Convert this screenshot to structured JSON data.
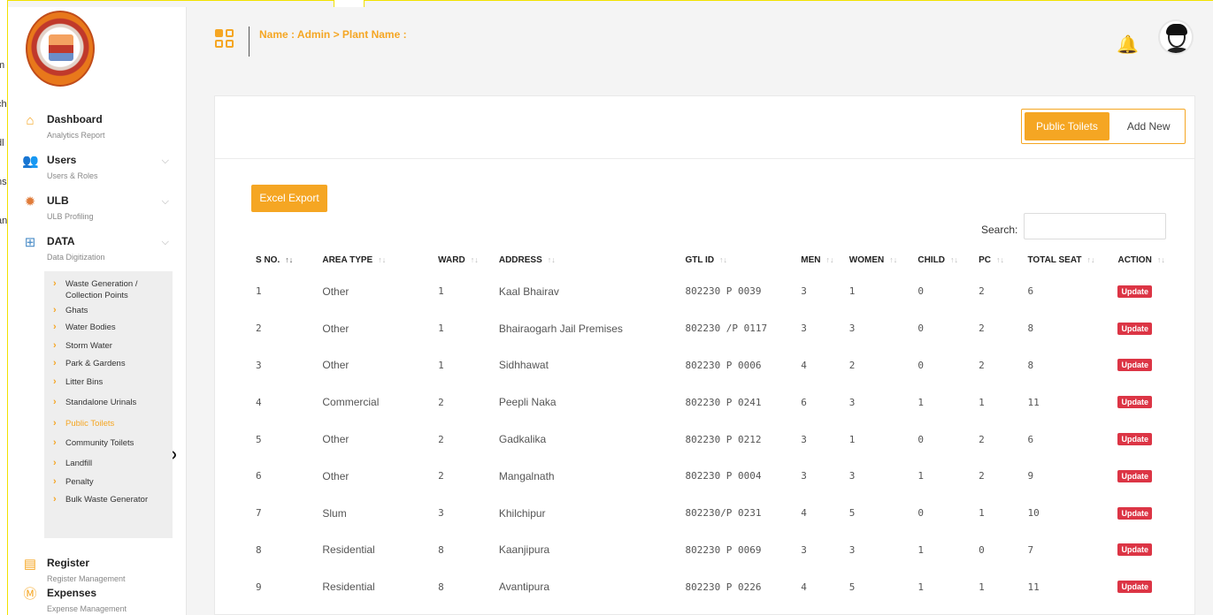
{
  "background_strip": [
    "m",
    "ch",
    "dl",
    "ns",
    "an"
  ],
  "header": {
    "breadcrumb": "Name : Admin > Plant Name :"
  },
  "sidebar": {
    "menu": [
      {
        "title": "Dashboard",
        "sub": "Analytics Report",
        "icon": "home-icon",
        "chevron": false
      },
      {
        "title": "Users",
        "sub": "Users & Roles",
        "icon": "users-icon",
        "chevron": true
      },
      {
        "title": "ULB",
        "sub": "ULB Profiling",
        "icon": "sun-icon",
        "chevron": true
      },
      {
        "title": "DATA",
        "sub": "Data Digitization",
        "icon": "data-icon",
        "chevron": true
      }
    ],
    "submenu": [
      {
        "label": "Waste Generation / Collection Points"
      },
      {
        "label": "Ghats"
      },
      {
        "label": "Water Bodies"
      },
      {
        "label": "Storm Water"
      },
      {
        "label": "Park & Gardens"
      },
      {
        "label": "Litter Bins"
      },
      {
        "label": "Standalone Urinals"
      },
      {
        "label": "Public Toilets"
      },
      {
        "label": "Community Toilets"
      },
      {
        "label": "Landfill"
      },
      {
        "label": "Penalty"
      },
      {
        "label": "Bulk Waste Generator"
      }
    ],
    "menu2": [
      {
        "title": "Register",
        "sub": "Register Management",
        "icon": "register-icon"
      },
      {
        "title": "Expenses",
        "sub": "Expense Management",
        "icon": "expenses-icon"
      }
    ]
  },
  "tabs": {
    "active": "Public Toilets",
    "other": "Add New"
  },
  "toolbar": {
    "excel_label": "Excel Export",
    "search_label": "Search:",
    "search_value": ""
  },
  "table": {
    "columns": [
      "S NO.",
      "AREA TYPE",
      "WARD",
      "ADDRESS",
      "GTL ID",
      "MEN",
      "WOMEN",
      "CHILD",
      "PC",
      "TOTAL SEAT",
      "ACTION"
    ],
    "action_label": "Update",
    "rows": [
      [
        "1",
        "Other",
        "1",
        "Kaal Bhairav",
        "802230 P 0039",
        "3",
        "1",
        "0",
        "2",
        "6"
      ],
      [
        "2",
        "Other",
        "1",
        "Bhairaogarh Jail Premises",
        "802230 /P 0117",
        "3",
        "3",
        "0",
        "2",
        "8"
      ],
      [
        "3",
        "Other",
        "1",
        "Sidhhawat",
        "802230 P 0006",
        "4",
        "2",
        "0",
        "2",
        "8"
      ],
      [
        "4",
        "Commercial",
        "2",
        "Peepli Naka",
        "802230 P 0241",
        "6",
        "3",
        "1",
        "1",
        "11"
      ],
      [
        "5",
        "Other",
        "2",
        "Gadkalika",
        "802230 P 0212",
        "3",
        "1",
        "0",
        "2",
        "6"
      ],
      [
        "6",
        "Other",
        "2",
        "Mangalnath",
        "802230 P 0004",
        "3",
        "3",
        "1",
        "2",
        "9"
      ],
      [
        "7",
        "Slum",
        "3",
        "Khilchipur",
        "802230/P 0231",
        "4",
        "5",
        "0",
        "1",
        "10"
      ],
      [
        "8",
        "Residential",
        "8",
        "Kaanjipura",
        "802230 P 0069",
        "3",
        "3",
        "1",
        "0",
        "7"
      ],
      [
        "9",
        "Residential",
        "8",
        "Avantipura",
        "802230 P 0226",
        "4",
        "5",
        "1",
        "1",
        "11"
      ]
    ]
  },
  "colors": {
    "accent": "#f5a623",
    "danger": "#dc3545"
  }
}
